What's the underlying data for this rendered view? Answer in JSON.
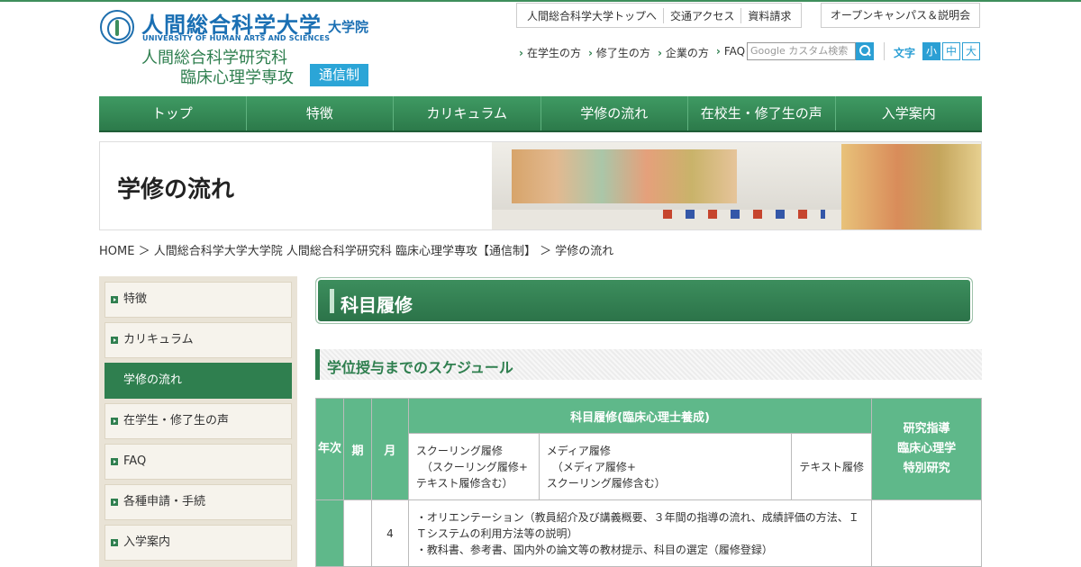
{
  "logo": {
    "university": "人間総合科学大学",
    "graduate": "大学院",
    "english": "UNIVERSITY OF HUMAN ARTS AND SCIENCES",
    "dept_line1": "人間総合科学研究科",
    "dept_line2": "臨床心理学専攻",
    "badge": "通信制"
  },
  "header_links": [
    "人間総合科学大学トップへ",
    "交通アクセス",
    "資料請求"
  ],
  "open_campus": "オープンキャンパス＆説明会",
  "sub_links": [
    "在学生の方",
    "修了生の方",
    "企業の方",
    "FAQ"
  ],
  "search": {
    "placeholder": "Google カスタム検索"
  },
  "font_size": {
    "label": "文字",
    "small": "小",
    "medium": "中",
    "large": "大"
  },
  "nav": [
    "トップ",
    "特徴",
    "カリキュラム",
    "学修の流れ",
    "在校生・修了生の声",
    "入学案内"
  ],
  "page_title": "学修の流れ",
  "breadcrumb": "HOME ＞ 人間総合科学大学大学院 人間総合科学研究科 臨床心理学専攻【通信制】 ＞ 学修の流れ",
  "sidebar": [
    "特徴",
    "カリキュラム",
    "学修の流れ",
    "在学生・修了生の声",
    "FAQ",
    "各種申請・手続",
    "入学案内"
  ],
  "section_title": "科目履修",
  "subsection_title": "学位授与までのスケジュール",
  "table": {
    "year": "年次",
    "term": "期",
    "month": "月",
    "course_header": "科目履修(臨床心理士養成)",
    "schooling": "スクーリング履修\n　（スクーリング履修+\nテキスト履修含む）",
    "media": "メディア履修\n　（メディア履修+\nスクーリング履修含む）",
    "text": "テキスト履修",
    "research": "研究指導\n臨床心理学\n特別研究",
    "row_month": "4",
    "row_content": "・オリエンテーション（教員紹介及び講義概要、３年間の指導の流れ、成績評価の方法、ＩＴシステムの利用方法等の説明）\n・教科書、参考書、国内外の論文等の教材提示、科目の選定（履修登録）"
  }
}
